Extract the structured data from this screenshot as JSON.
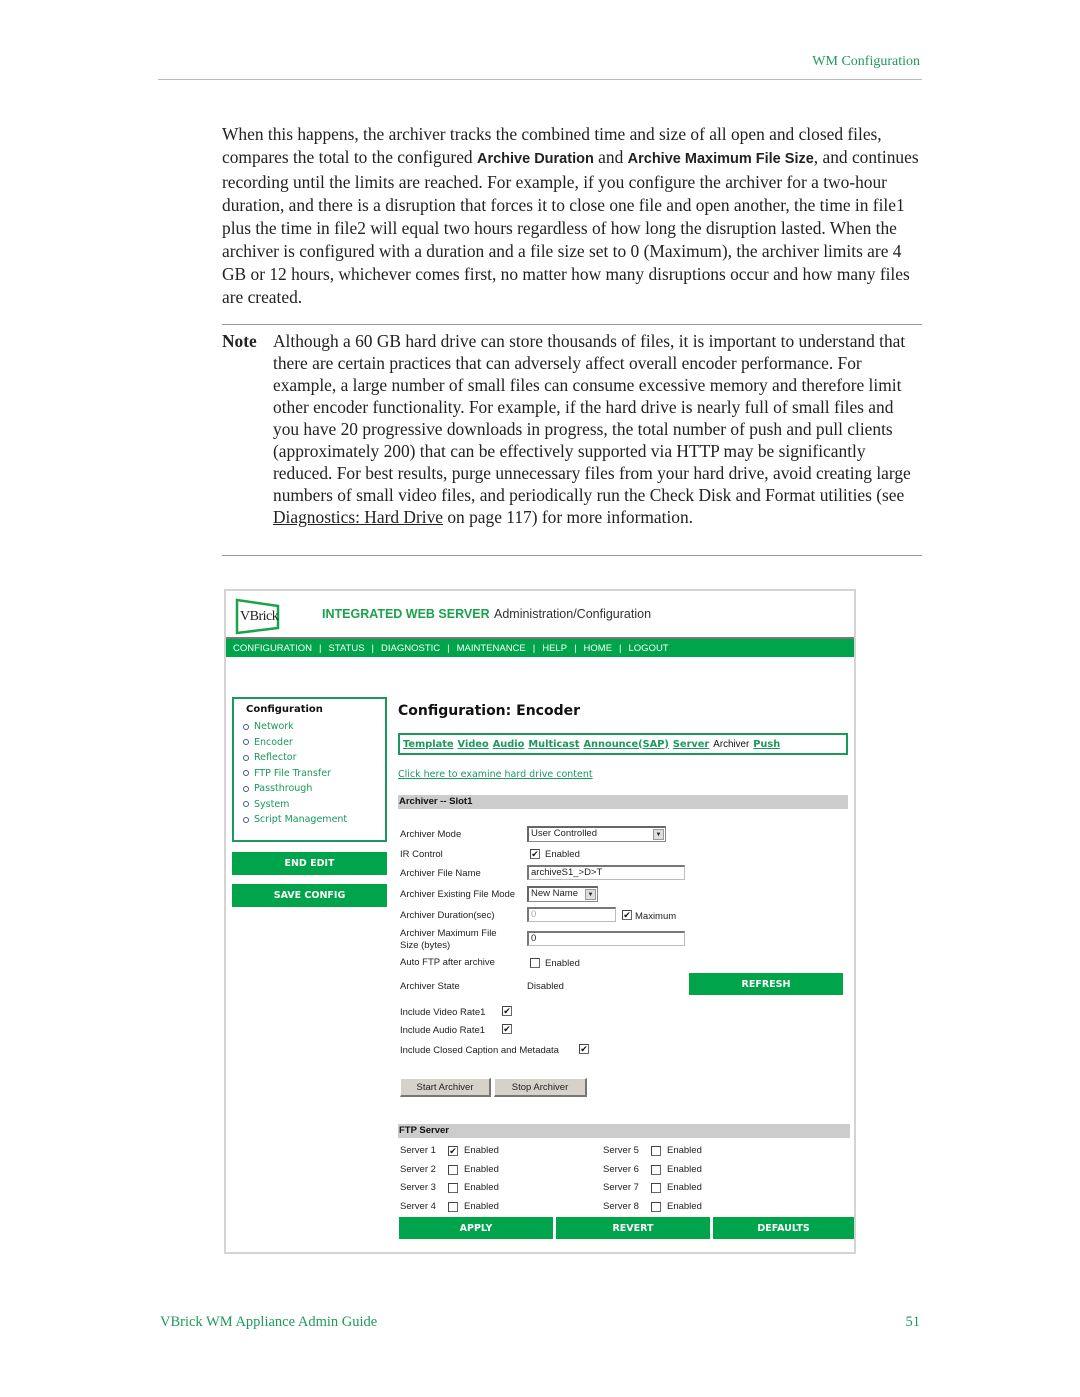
{
  "page": {
    "header_title": "WM Configuration",
    "footer_title": "VBrick WM Appliance Admin Guide",
    "page_number": "51"
  },
  "body": {
    "p1_a": "When this happens, the archiver tracks the combined time and size of all open and closed files, compares the total to the configured ",
    "p1_b1": "Archive Duration",
    "p1_c": " and ",
    "p1_b2": "Archive Maximum File Size",
    "p1_d": ", and continues recording until the limits are reached. For example, if you configure the archiver for a two-hour duration, and there is a disruption that forces it to close one file and open another, the time in file1 plus the time in file2 will equal two hours regardless of how long the disruption lasted. When the archiver is configured with a duration and a file size set to 0 (Maximum), the archiver limits are 4 GB or 12 hours, whichever comes first, no matter how many disruptions occur and how many files are created."
  },
  "note": {
    "label": "Note",
    "text_a": "Although a 60 GB hard drive can store thousands of files, it is important to understand that there are certain practices that can adversely affect overall encoder performance. For example, a large number of small files can consume excessive memory and therefore limit other encoder functionality. For example, if the hard drive is nearly full of small files and you have 20 progressive downloads in progress, the total number of push and pull clients (approximately 200) that can be effectively supported via HTTP may be significantly reduced. For best results, purge unnecessary files from your hard drive, avoid creating large numbers of small video files, and periodically run the Check Disk and Format utilities (see ",
    "link": "Diagnostics: Hard Drive",
    "text_b": " on page 117) for more information."
  },
  "app": {
    "logo_text": "VBrick",
    "product": "INTEGRATED WEB SERVER",
    "subtitle": "Administration/Configuration",
    "nav": [
      "CONFIGURATION",
      "STATUS",
      "DIAGNOSTIC",
      "MAINTENANCE",
      "HELP",
      "HOME",
      "LOGOUT"
    ],
    "sidebar": {
      "title": "Configuration",
      "items": [
        "Network",
        "Encoder",
        "Reflector",
        "FTP File Transfer",
        "Passthrough",
        "System",
        "Script Management"
      ],
      "end_edit": "END EDIT",
      "save_config": "SAVE CONFIG"
    },
    "main_title": "Configuration: Encoder",
    "subtabs": [
      "Template",
      "Video",
      "Audio",
      "Multicast",
      "Announce(SAP)",
      "Server",
      "Archiver",
      "Push"
    ],
    "active_subtab": "Archiver",
    "hd_link": "Click here to examine hard drive content",
    "archiver_section": "Archiver -- Slot1",
    "fields": {
      "mode_label": "Archiver Mode",
      "mode_value": "User Controlled",
      "ir_label": "IR Control",
      "ir_check": "Enabled",
      "ir_checked": true,
      "filename_label": "Archiver File Name",
      "filename_value": "archiveS1_>D>T",
      "existing_label": "Archiver Existing File Mode",
      "existing_value": "New Name",
      "duration_label": "Archiver Duration(sec)",
      "duration_value": "0",
      "duration_max_label": "Maximum",
      "duration_max_checked": true,
      "maxsize_label_1": "Archiver Maximum File",
      "maxsize_label_2": "Size (bytes)",
      "maxsize_value": "0",
      "autoftp_label": "Auto FTP after archive",
      "autoftp_check": "Enabled",
      "autoftp_checked": false,
      "state_label": "Archiver State",
      "state_value": "Disabled",
      "refresh": "REFRESH",
      "video_label": "Include Video Rate1",
      "audio_label": "Include Audio Rate1",
      "cc_label": "Include Closed Caption and Metadata",
      "start": "Start Archiver",
      "stop": "Stop Archiver"
    },
    "ftp_section": "FTP Server",
    "ftp_servers": [
      {
        "label": "Server 1",
        "check": "Enabled",
        "checked": true
      },
      {
        "label": "Server 2",
        "check": "Enabled",
        "checked": false
      },
      {
        "label": "Server 3",
        "check": "Enabled",
        "checked": false
      },
      {
        "label": "Server 4",
        "check": "Enabled",
        "checked": false
      },
      {
        "label": "Server 5",
        "check": "Enabled",
        "checked": false
      },
      {
        "label": "Server 6",
        "check": "Enabled",
        "checked": false
      },
      {
        "label": "Server 7",
        "check": "Enabled",
        "checked": false
      },
      {
        "label": "Server 8",
        "check": "Enabled",
        "checked": false
      }
    ],
    "buttons": {
      "apply": "APPLY",
      "revert": "REVERT",
      "defaults": "DEFAULTS"
    },
    "colors": {
      "brand_green": "#00a44b",
      "link_green": "#1a9a5a",
      "section_gray": "#cccccc"
    }
  }
}
